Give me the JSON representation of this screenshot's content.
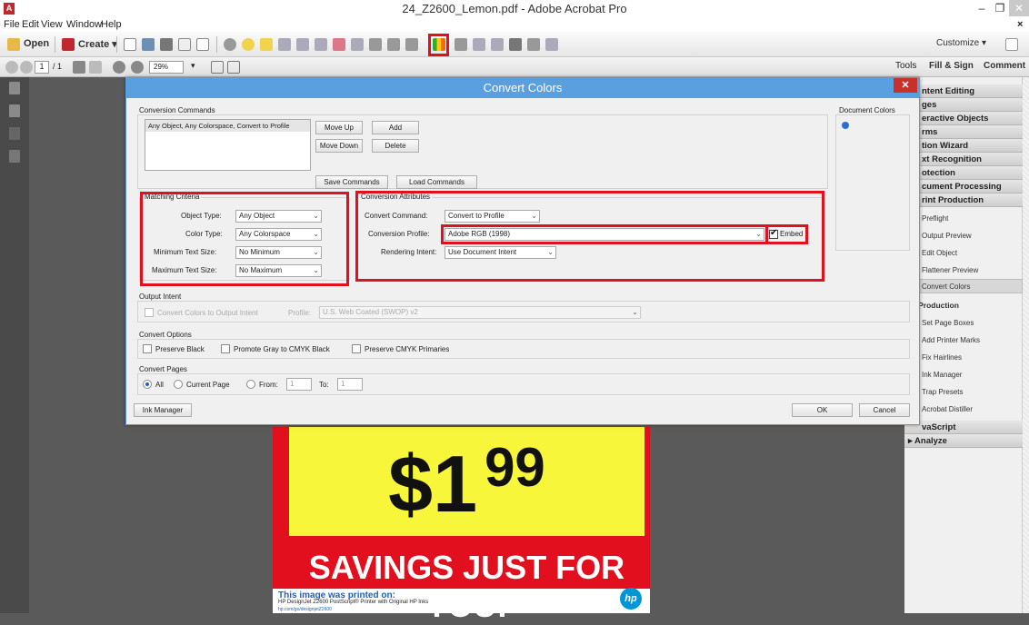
{
  "window": {
    "title": "24_Z2600_Lemon.pdf - Adobe Acrobat Pro",
    "app_icon": "acrobat-icon",
    "buttons": [
      "–",
      "❐",
      "✕"
    ]
  },
  "menu": [
    "File",
    "Edit",
    "View",
    "Window",
    "Help"
  ],
  "menu_close": "×",
  "toolbar": {
    "open": "Open",
    "create": "Create ▾",
    "customize": "Customize ▾"
  },
  "nav": {
    "page": "1",
    "total": "/ 1",
    "zoom": "29%",
    "tools": "Tools",
    "fill_sign": "Fill & Sign",
    "comment": "Comment"
  },
  "dialog": {
    "title": "Convert Colors",
    "close": "✕",
    "conversion_commands": {
      "label": "Conversion Commands",
      "items": [
        "Any Object, Any Colorspace, Convert to Profile"
      ],
      "move_up": "Move Up",
      "add": "Add",
      "move_down": "Move Down",
      "delete": "Delete",
      "save": "Save Commands",
      "load": "Load Commands"
    },
    "document_colors": "Document Colors",
    "matching": {
      "label": "Matching Criteria",
      "object_type_label": "Object Type:",
      "object_type": "Any Object",
      "color_type_label": "Color Type:",
      "color_type": "Any Colorspace",
      "min_text_label": "Minimum Text Size:",
      "min_text": "No Minimum",
      "max_text_label": "Maximum Text Size:",
      "max_text": "No Maximum"
    },
    "attributes": {
      "label": "Conversion Attributes",
      "command_label": "Convert Command:",
      "command": "Convert to Profile",
      "profile_label": "Conversion Profile:",
      "profile": "Adobe RGB (1998)",
      "embed_label": "Embed",
      "embed_checked": true,
      "intent_label": "Rendering Intent:",
      "intent": "Use Document Intent"
    },
    "output_intent": {
      "label": "Output Intent",
      "checkbox": "Convert Colors to Output Intent",
      "profile_label": "Profile:",
      "profile": "U.S. Web Coated (SWOP) v2"
    },
    "convert_options": {
      "label": "Convert Options",
      "preserve_black": "Preserve Black",
      "promote_gray": "Promote Gray to CMYK Black",
      "preserve_cmyk": "Preserve CMYK Primaries"
    },
    "convert_pages": {
      "label": "Convert Pages",
      "all": "All",
      "current": "Current Page",
      "from": "From:",
      "from_val": "1",
      "to": "To:",
      "to_val": "1"
    },
    "ink_manager": "Ink Manager",
    "ok": "OK",
    "cancel": "Cancel"
  },
  "right_panel": {
    "headers": [
      "ntent Editing",
      "ges",
      "eractive Objects",
      "rms",
      "tion Wizard",
      "xt Recognition",
      "otection",
      "cument Processing",
      "rint Production"
    ],
    "print_items": [
      "Preflight",
      "Output Preview",
      "Edit Object",
      "Flattener Preview",
      "Convert Colors"
    ],
    "prepress_header": "e Production",
    "prepress_items": [
      "Set Page Boxes",
      "Add Printer Marks",
      "Fix Hairlines",
      "Ink Manager",
      "Trap Presets",
      "Acrobat Distiller"
    ],
    "javascript": "vaScript",
    "analyze": "▸ Analyze"
  },
  "document": {
    "price": "$1",
    "price_cents": "99",
    "savings": "SAVINGS JUST FOR YOU!",
    "footer_title": "This image was printed on:",
    "footer_line": "HP DesignJet Z2600 PostScript® Printer with Original HP Inks",
    "footer_url": "hp.com/go/designjetZ2600",
    "hp_logo": "hp"
  },
  "colors": {
    "dialog_title": "#5a9fe0",
    "highlight": "#e2101f",
    "sign_yellow": "#f8f63a",
    "sign_red": "#e2101f",
    "hp_blue": "#0096d6"
  }
}
